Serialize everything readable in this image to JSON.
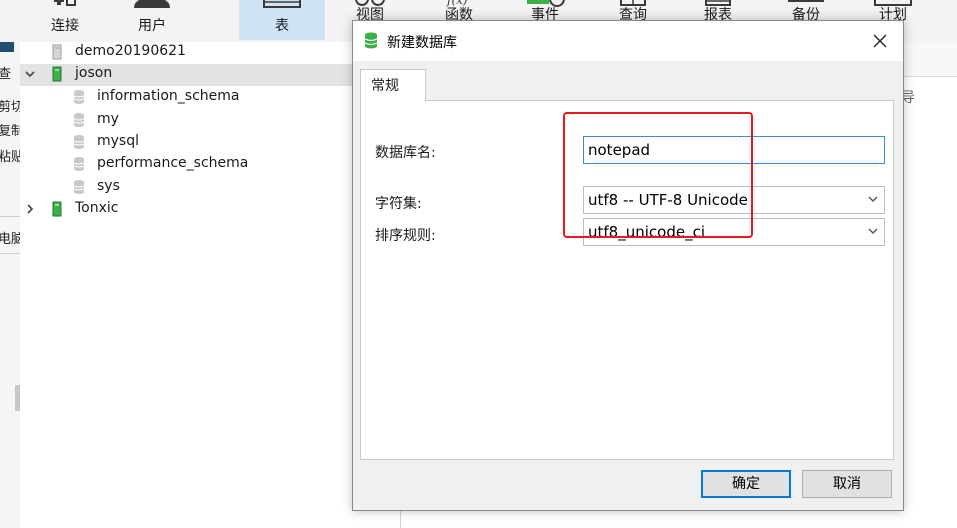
{
  "toolbar": {
    "items": [
      {
        "label": "连接"
      },
      {
        "label": "用户"
      },
      {
        "label": "表"
      },
      {
        "label": "视图"
      },
      {
        "label": "函数"
      },
      {
        "label": "事件"
      },
      {
        "label": "查询"
      },
      {
        "label": "报表"
      },
      {
        "label": "备份"
      },
      {
        "label": "计划"
      }
    ]
  },
  "left_strip": {
    "items": [
      "查",
      "剪切",
      "复制",
      "粘贴",
      "电脑"
    ]
  },
  "tree": {
    "connections": [
      {
        "label": "demo20190621",
        "expanded": false
      },
      {
        "label": "joson",
        "expanded": true,
        "databases": [
          "information_schema",
          "my",
          "mysql",
          "performance_schema",
          "sys"
        ]
      },
      {
        "label": "Tonxic",
        "expanded": false
      }
    ]
  },
  "right_panel": {
    "export_label": "导"
  },
  "dialog": {
    "title": "新建数据库",
    "close_symbol": "✕",
    "tab_label": "常规",
    "fields": {
      "db_name_label": "数据库名:",
      "db_name_value": "notepad",
      "charset_label": "字符集:",
      "charset_value": "utf8 -- UTF-8 Unicode",
      "collation_label": "排序规则:",
      "collation_value": "utf8_unicode_ci"
    },
    "ok_label": "确定",
    "cancel_label": "取消"
  },
  "colors": {
    "accent": "#0078d7",
    "highlight": "#e8191c",
    "selected_row": "#e3e3e3",
    "active_tool": "#cfe3f5",
    "db_icon_green": "#3cae4a"
  },
  "icons": {
    "server": "server-icon",
    "database": "database-icon",
    "chevron_down": "chevron-down-icon",
    "chevron_right": "chevron-right-icon",
    "close": "close-icon",
    "new_db": "database-green-icon"
  }
}
